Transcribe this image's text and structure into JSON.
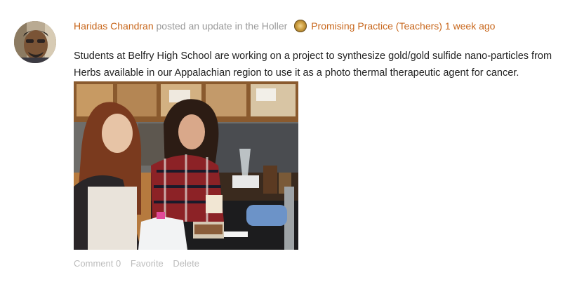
{
  "post": {
    "user_name": "Haridas Chandran",
    "action_text": "posted an update in the Holler",
    "group_icon": "group-badge-icon",
    "group_name": "Promising Practice (Teachers)",
    "time_ago": "1 week ago",
    "body": "Students at Belfry High School are working on a project to synthesize gold/gold sulfide nano-particles from Herbs available in our Appalachian region to use it as a photo thermal therapeutic agent for cancer.",
    "photo_icon": "lab-photo-image"
  },
  "actions": {
    "comment_label": "Comment 0",
    "favorite_label": "Favorite",
    "delete_label": "Delete"
  },
  "colors": {
    "link": "#c8671c",
    "meta": "#9a9a9a",
    "actions": "#bcbcbc",
    "text": "#222222"
  }
}
